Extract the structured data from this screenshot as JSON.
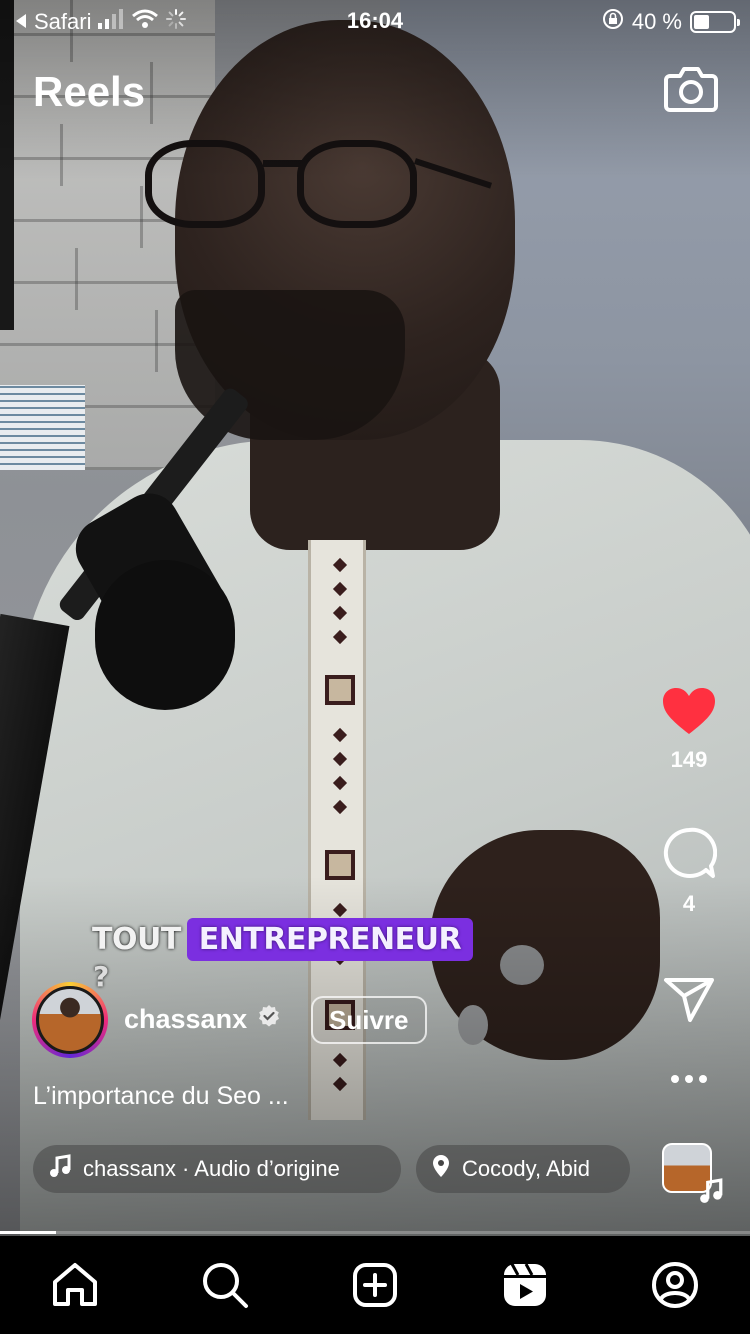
{
  "status_bar": {
    "back_app": "Safari",
    "time": "16:04",
    "battery_text": "40 %",
    "battery_level": 0.4
  },
  "header": {
    "title": "Reels"
  },
  "actions": {
    "likes": "149",
    "comments": "4",
    "like_color": "#ff3040"
  },
  "overlay_caption": {
    "word1": "TOUT",
    "word2": "ENTREPRENEUR",
    "line2": "?",
    "highlight_color": "#7b2fe0"
  },
  "author": {
    "username": "chassanx",
    "follow_label": "Suivre"
  },
  "caption": "L’importance du Seo ...",
  "audio": {
    "label": "chassanx · Audio d’origine"
  },
  "location": {
    "label": "Cocody, Abid"
  },
  "progress": 0.075,
  "icons": {
    "back": "back-arrow-icon",
    "signal": "signal-bars-icon",
    "wifi": "wifi-icon",
    "loading": "activity-spinner-icon",
    "orientation_lock": "orientation-lock-icon",
    "camera": "camera-icon",
    "like": "heart-icon",
    "comment": "comment-bubble-icon",
    "share": "paper-plane-icon",
    "more": "more-dots-icon",
    "verified": "verified-badge-icon",
    "music": "music-note-icon",
    "location": "location-pin-icon",
    "tabs": [
      "home-icon",
      "search-icon",
      "create-icon",
      "reels-icon",
      "profile-icon"
    ]
  }
}
